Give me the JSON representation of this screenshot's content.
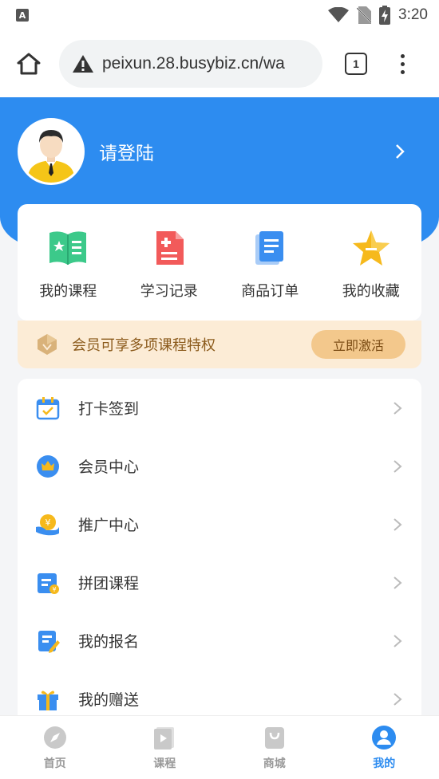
{
  "status_bar": {
    "time": "3:20",
    "notification_icon": "A"
  },
  "browser": {
    "url": "peixun.28.busybiz.cn/wa",
    "tab_count": "1"
  },
  "profile": {
    "login_text": "请登陆"
  },
  "quick_actions": [
    {
      "label": "我的课程",
      "icon": "course-book-icon",
      "color": "#3cc98a"
    },
    {
      "label": "学习记录",
      "icon": "study-record-icon",
      "color": "#f25a5a"
    },
    {
      "label": "商品订单",
      "icon": "order-document-icon",
      "color": "#3a8ef0"
    },
    {
      "label": "我的收藏",
      "icon": "favorite-star-icon",
      "color": "#f6b91c"
    }
  ],
  "member_banner": {
    "text": "会员可享多项课程特权",
    "button": "立即激活"
  },
  "menu": [
    {
      "label": "打卡签到",
      "icon": "calendar-check-icon"
    },
    {
      "label": "会员中心",
      "icon": "crown-icon"
    },
    {
      "label": "推广中心",
      "icon": "promotion-coin-icon"
    },
    {
      "label": "拼团课程",
      "icon": "group-course-icon"
    },
    {
      "label": "我的报名",
      "icon": "signup-edit-icon"
    },
    {
      "label": "我的赠送",
      "icon": "gift-icon"
    }
  ],
  "bottom_nav": [
    {
      "label": "首页",
      "icon": "compass-icon",
      "active": false
    },
    {
      "label": "课程",
      "icon": "video-course-icon",
      "active": false
    },
    {
      "label": "商城",
      "icon": "shopping-bag-icon",
      "active": false
    },
    {
      "label": "我的",
      "icon": "user-profile-icon",
      "active": true
    }
  ],
  "colors": {
    "primary": "#2d8cf0",
    "banner_bg": "#fcecd6",
    "banner_button": "#f3c88c"
  }
}
